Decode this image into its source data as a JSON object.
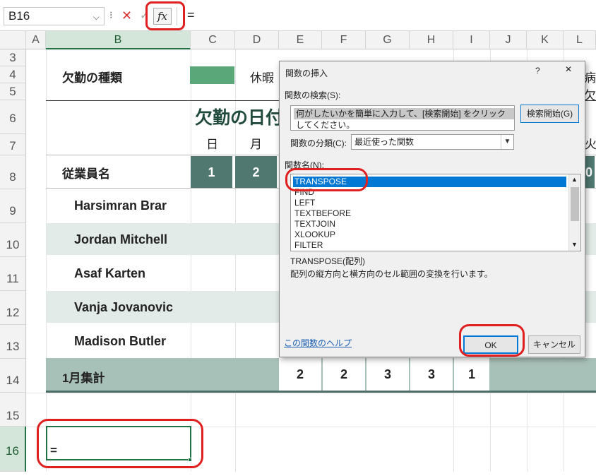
{
  "formula_bar": {
    "name_box": "B16",
    "formula": "=",
    "fx_label": "fx"
  },
  "columns": [
    "A",
    "B",
    "C",
    "D",
    "E",
    "F",
    "G",
    "H",
    "I",
    "J",
    "K",
    "L"
  ],
  "rows": [
    "3",
    "4",
    "5",
    "6",
    "7",
    "8",
    "9",
    "10",
    "11",
    "12",
    "13",
    "14",
    "15",
    "16"
  ],
  "sheet": {
    "absence_type_label": "欠勤の種類",
    "legend_vacation": "休暇",
    "legend_sick_partial": "病欠",
    "title_partial": "欠勤の日付",
    "weekday_labels": [
      "日",
      "月"
    ],
    "weekday_right_partial": "火",
    "employee_header": "従業員名",
    "day_numbers": [
      "1",
      "2"
    ],
    "day_right_partial": "0",
    "employees": [
      "Harsimran Brar",
      "Jordan Mitchell",
      "Asaf Karten",
      "Vanja Jovanovic",
      "Madison Butler"
    ],
    "total_label": "1月集計",
    "totals": [
      "2",
      "2",
      "3",
      "3",
      "1"
    ],
    "active_cell_value": "="
  },
  "dialog": {
    "title": "関数の挿入",
    "help_glyph": "?",
    "close_glyph": "✕",
    "search_label": "関数の検索(S):",
    "search_placeholder": "何がしたいかを簡単に入力して、[検索開始] をクリックしてください。",
    "search_button": "検索開始(G)",
    "category_label": "関数の分類(C):",
    "category_value": "最近使った関数",
    "function_name_label": "関数名(N):",
    "functions": [
      "TRANSPOSE",
      "FIND",
      "LEFT",
      "TEXTBEFORE",
      "TEXTJOIN",
      "XLOOKUP",
      "FILTER"
    ],
    "selected_function": "TRANSPOSE",
    "syntax": "TRANSPOSE(配列)",
    "description": "配列の縦方向と横方向のセル範囲の変換を行います。",
    "help_link": "この関数のヘルプ",
    "ok": "OK",
    "cancel": "キャンセル"
  },
  "colors": {
    "header_dark": "#507770",
    "band_light": "#e2ebe7",
    "total_row": "#a8c1b8",
    "legend_green": "#5aa77a",
    "accent_red": "#e02020",
    "excel_green": "#217346"
  }
}
